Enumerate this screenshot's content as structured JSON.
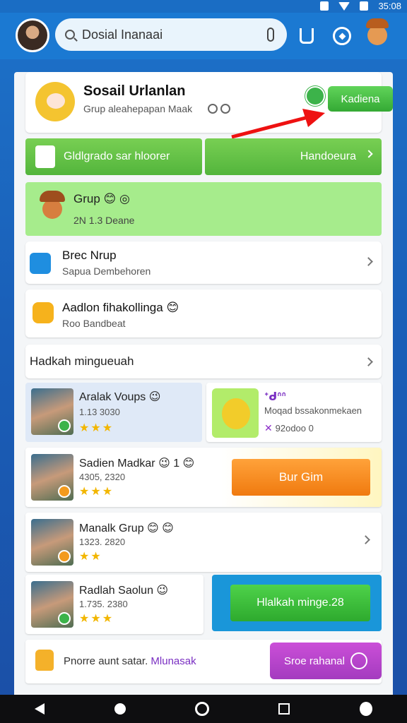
{
  "status": {
    "time": "35:08"
  },
  "search": {
    "value": "Dosial Inanaai"
  },
  "header": {
    "title": "Sosail Urlanlan",
    "subtitle": "Grup aleahepapan Maak",
    "button_label": "Kadiena"
  },
  "greenbar": {
    "left_label": "Gldlgrado sar hloorer",
    "right_label": "Handoeura"
  },
  "grup_card": {
    "title": "Grup 😊 ◎",
    "sub": "2N 1.3 Deane"
  },
  "rows": [
    {
      "title": "Brec Nrup",
      "sub": "Sapua Dembehoren"
    },
    {
      "title": "Aadlon fihakollinga 😊",
      "sub": "Roo Bandbeat"
    }
  ],
  "section": {
    "title": "Hadkah mingueuah"
  },
  "mini_cards": [
    {
      "title": "Aralak Voups 😉",
      "sub": "1.13 3030",
      "stars": "★★★"
    },
    {
      "title": "ᐩᑯᐢᐢ",
      "sub": "Moqad bssakonmekaen",
      "meta": "92odoo 0"
    }
  ],
  "list": [
    {
      "title": "Sadien Madkar 😉 1 😊",
      "sub": "4305, 2320",
      "stars": "★★★",
      "button": "Bur Gim"
    },
    {
      "title": "Manalk Grup 😊 😊",
      "sub": "1323. 2820",
      "stars": "★★"
    },
    {
      "title": "Radlah Saolun 😉",
      "sub": "1.735. 2380",
      "stars": "★★★",
      "button": "Hlalkah minge.28"
    }
  ],
  "bottom": {
    "text": "Pnorre aunt satar.",
    "link": "Mlunasak",
    "button": "Sroe rahanal"
  },
  "colors": {
    "brand_blue": "#1b79d2",
    "green": "#53b53c",
    "orange": "#f07a0f",
    "magenta": "#a43bbf"
  }
}
